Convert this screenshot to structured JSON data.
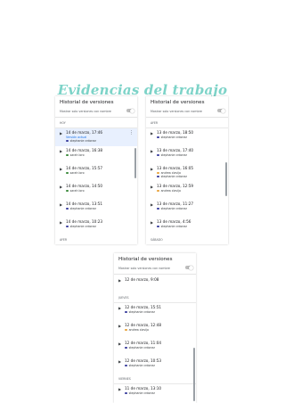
{
  "page_title": "Evidencias del trabajo",
  "colors": {
    "title": "#7dd3c8",
    "selected_bg": "#e8f0fe",
    "current_label": "#1a73e8"
  },
  "panels": [
    {
      "header": "Historial de versiones",
      "toggle_label": "Mostrar solo versiones con nombre",
      "items": [
        {
          "kind": "section",
          "label": "HOY"
        },
        {
          "kind": "version",
          "date": "14 de marzo, 17:46",
          "current": "Versión actual",
          "selected": true,
          "authors": [
            {
              "name": "stephanie crdonez",
              "color": "#3b3f9e"
            }
          ]
        },
        {
          "kind": "version",
          "date": "14 de marzo, 16:38",
          "authors": [
            {
              "name": "sarah loro",
              "color": "#3c8a3c"
            }
          ]
        },
        {
          "kind": "version",
          "date": "14 de marzo, 15:57",
          "authors": [
            {
              "name": "sarah loro",
              "color": "#3c8a3c"
            }
          ]
        },
        {
          "kind": "version",
          "date": "14 de marzo, 14:50",
          "authors": [
            {
              "name": "sarah loro",
              "color": "#3c8a3c"
            }
          ]
        },
        {
          "kind": "version",
          "date": "14 de marzo, 13:51",
          "authors": [
            {
              "name": "stephanie crdonez",
              "color": "#3b3f9e"
            }
          ]
        },
        {
          "kind": "version",
          "date": "14 de marzo, 10:23",
          "authors": [
            {
              "name": "stephanie crdonez",
              "color": "#3b3f9e"
            }
          ]
        },
        {
          "kind": "section",
          "label": "AYER"
        },
        {
          "kind": "version",
          "date": "13 de marzo, 18:50",
          "authors": []
        }
      ]
    },
    {
      "header": "Historial de versiones",
      "toggle_label": "Mostrar solo versiones con nombre",
      "items": [
        {
          "kind": "section",
          "label": "AYER"
        },
        {
          "kind": "version",
          "date": "13 de marzo, 18:50",
          "authors": [
            {
              "name": "stephanie crdonez",
              "color": "#3b3f9e"
            }
          ]
        },
        {
          "kind": "version",
          "date": "13 de marzo, 17:40",
          "authors": [
            {
              "name": "stephanie crdonez",
              "color": "#3b3f9e"
            }
          ]
        },
        {
          "kind": "version",
          "date": "13 de marzo, 16:05",
          "authors": [
            {
              "name": "andrea clavijo",
              "color": "#e8a33d"
            },
            {
              "name": "stephanie crdonez",
              "color": "#3b3f9e"
            }
          ]
        },
        {
          "kind": "version",
          "date": "13 de marzo, 12:59",
          "authors": [
            {
              "name": "andrea clavijo",
              "color": "#e8a33d"
            }
          ]
        },
        {
          "kind": "version",
          "date": "13 de marzo, 11:27",
          "authors": [
            {
              "name": "stephanie crdonez",
              "color": "#3b3f9e"
            }
          ]
        },
        {
          "kind": "version",
          "date": "13 de marzo, 4:56",
          "authors": [
            {
              "name": "stephanie crdonez",
              "color": "#3b3f9e"
            }
          ]
        },
        {
          "kind": "section",
          "label": "SÁBADO"
        }
      ]
    },
    {
      "header": "Historial de versiones",
      "toggle_label": "Mostrar solo versiones con nombre",
      "items": [
        {
          "kind": "version",
          "date": "12 de marzo, 9:08",
          "authors": []
        },
        {
          "kind": "section",
          "label": "JUEVES"
        },
        {
          "kind": "version",
          "date": "12 de marzo, 15:51",
          "authors": [
            {
              "name": "stephanie crdonez",
              "color": "#3b3f9e"
            }
          ]
        },
        {
          "kind": "version",
          "date": "12 de marzo, 12:48",
          "authors": [
            {
              "name": "andrea clavijo",
              "color": "#e8a33d"
            }
          ]
        },
        {
          "kind": "version",
          "date": "12 de marzo, 11:04",
          "authors": [
            {
              "name": "stephanie crdonez",
              "color": "#3b3f9e"
            }
          ]
        },
        {
          "kind": "version",
          "date": "12 de marzo, 10:53",
          "authors": [
            {
              "name": "stephanie crdonez",
              "color": "#3b3f9e"
            }
          ]
        },
        {
          "kind": "section",
          "label": "VIERNES"
        },
        {
          "kind": "version",
          "date": "11 de marzo, 13:10",
          "authors": [
            {
              "name": "stephanie crdonez",
              "color": "#3b3f9e"
            }
          ]
        },
        {
          "kind": "version",
          "date": "11 de marzo, 14:42",
          "authors": [
            {
              "name": "stephanie crdonez",
              "color": "#3b3f9e"
            }
          ]
        }
      ]
    }
  ]
}
